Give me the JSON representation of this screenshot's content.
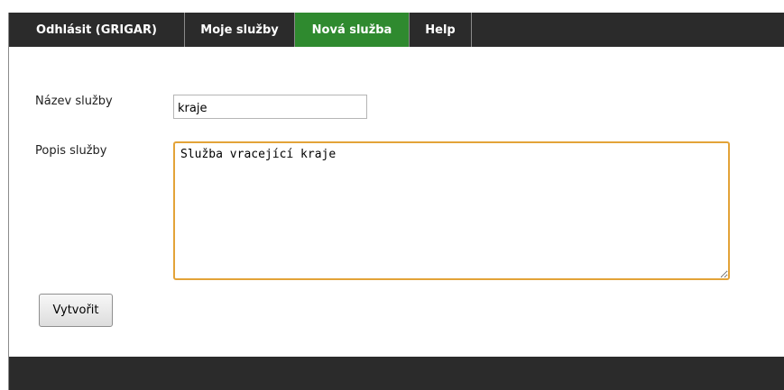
{
  "nav": {
    "logout_label": "Odhlásit (GRIGAR)",
    "my_services_label": "Moje služby",
    "new_service_label": "Nová služba",
    "help_label": "Help",
    "active_tab": "Nová služba"
  },
  "form": {
    "name_label": "Název služby",
    "name_value": "kraje",
    "description_label": "Popis služby",
    "description_value": "Služba vracející kraje",
    "create_button_label": "Vytvořit"
  },
  "colors": {
    "nav_background": "#2b2b2b",
    "active_tab": "#2f8a2f",
    "focus_border": "#e3a338"
  }
}
